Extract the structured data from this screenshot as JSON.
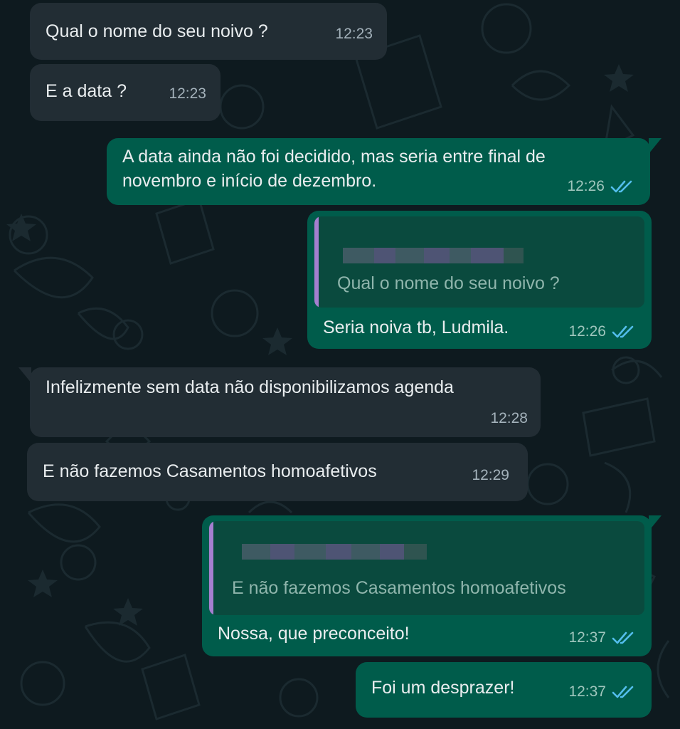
{
  "theme": {
    "wallpaper": "#0e1a1f",
    "incoming_bubble": "#222d34",
    "outgoing_bubble": "#005c4b",
    "read_tick_color": "#53bdeb"
  },
  "messages": [
    {
      "direction": "incoming",
      "text": "Qual o nome do seu noivo ?",
      "time": "12:23"
    },
    {
      "direction": "incoming",
      "text": "E a data ?",
      "time": "12:23"
    },
    {
      "direction": "outgoing",
      "text_lines": [
        "A data ainda não foi decidido, mas seria entre final de",
        "novembro e início de dezembro."
      ],
      "time": "12:26",
      "status": "read"
    },
    {
      "direction": "outgoing",
      "quoted": {
        "author": "(blurred contact name)",
        "text": "Qual o nome do seu noivo ?"
      },
      "text": "Seria noiva tb, Ludmila.",
      "time": "12:26",
      "status": "read"
    },
    {
      "direction": "incoming",
      "text": "Infelizmente sem data não disponibilizamos agenda",
      "time": "12:28"
    },
    {
      "direction": "incoming",
      "text": "E não fazemos Casamentos homoafetivos",
      "time": "12:29"
    },
    {
      "direction": "outgoing",
      "quoted": {
        "author": "(blurred contact name)",
        "text": "E não fazemos Casamentos homoafetivos"
      },
      "text": "Nossa, que preconceito!",
      "time": "12:37",
      "status": "read"
    },
    {
      "direction": "outgoing",
      "text": "Foi um desprazer!",
      "time": "12:37",
      "status": "read"
    }
  ]
}
